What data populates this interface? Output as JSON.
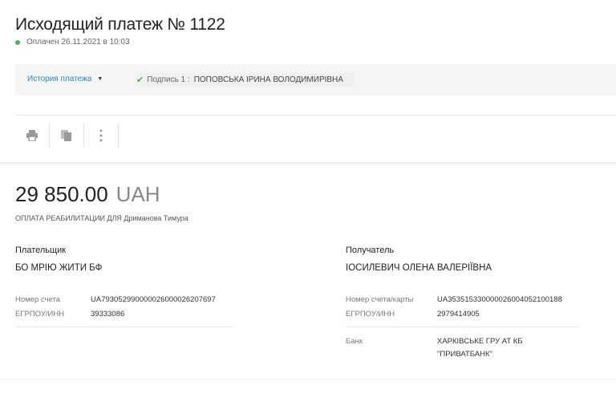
{
  "payment": {
    "title": "Исходящий платеж № 1122",
    "status": "Оплачен 26.11.2021 в 10:03",
    "status_color": "#4caf50"
  },
  "history": {
    "link_label": "История платежа",
    "sign_label": "Подпись 1 :",
    "sign_name": "ПОПОВСЬКА ІРИНА ВОЛОДИМИРІВНА"
  },
  "toolbar": {
    "icons": [
      "print-icon",
      "copy-icon",
      "more-icon"
    ]
  },
  "amount": {
    "value": "29 850.00",
    "currency": "UAH",
    "purpose": "ОПЛАТА РЕАБИЛИТАЦИИ ДЛЯ Дриманова Тимура"
  },
  "payer": {
    "heading": "Плательщик",
    "name": "БО МРІЮ ЖИТИ БФ",
    "account_label": "Номер счета",
    "account": "UA793052990000026000026207697",
    "edrpou_label": "ЕГРПОУ/ИНН",
    "edrpou": "39333086"
  },
  "recipient": {
    "heading": "Получатель",
    "name": "ІОСИЛЕВИЧ ОЛЕНА ВАЛЕРІЇВНА",
    "account_label": "Номер счета/карты",
    "account": "UA353515330000026004052100188",
    "edrpou_label": "ЕГРПОУ/ИНН",
    "edrpou": "2979414905",
    "bank_label": "Банк",
    "bank_line1": "ХАРКІВСЬКЕ ГРУ АТ КБ",
    "bank_line2": "\"ПРИВАТБАНК\""
  }
}
